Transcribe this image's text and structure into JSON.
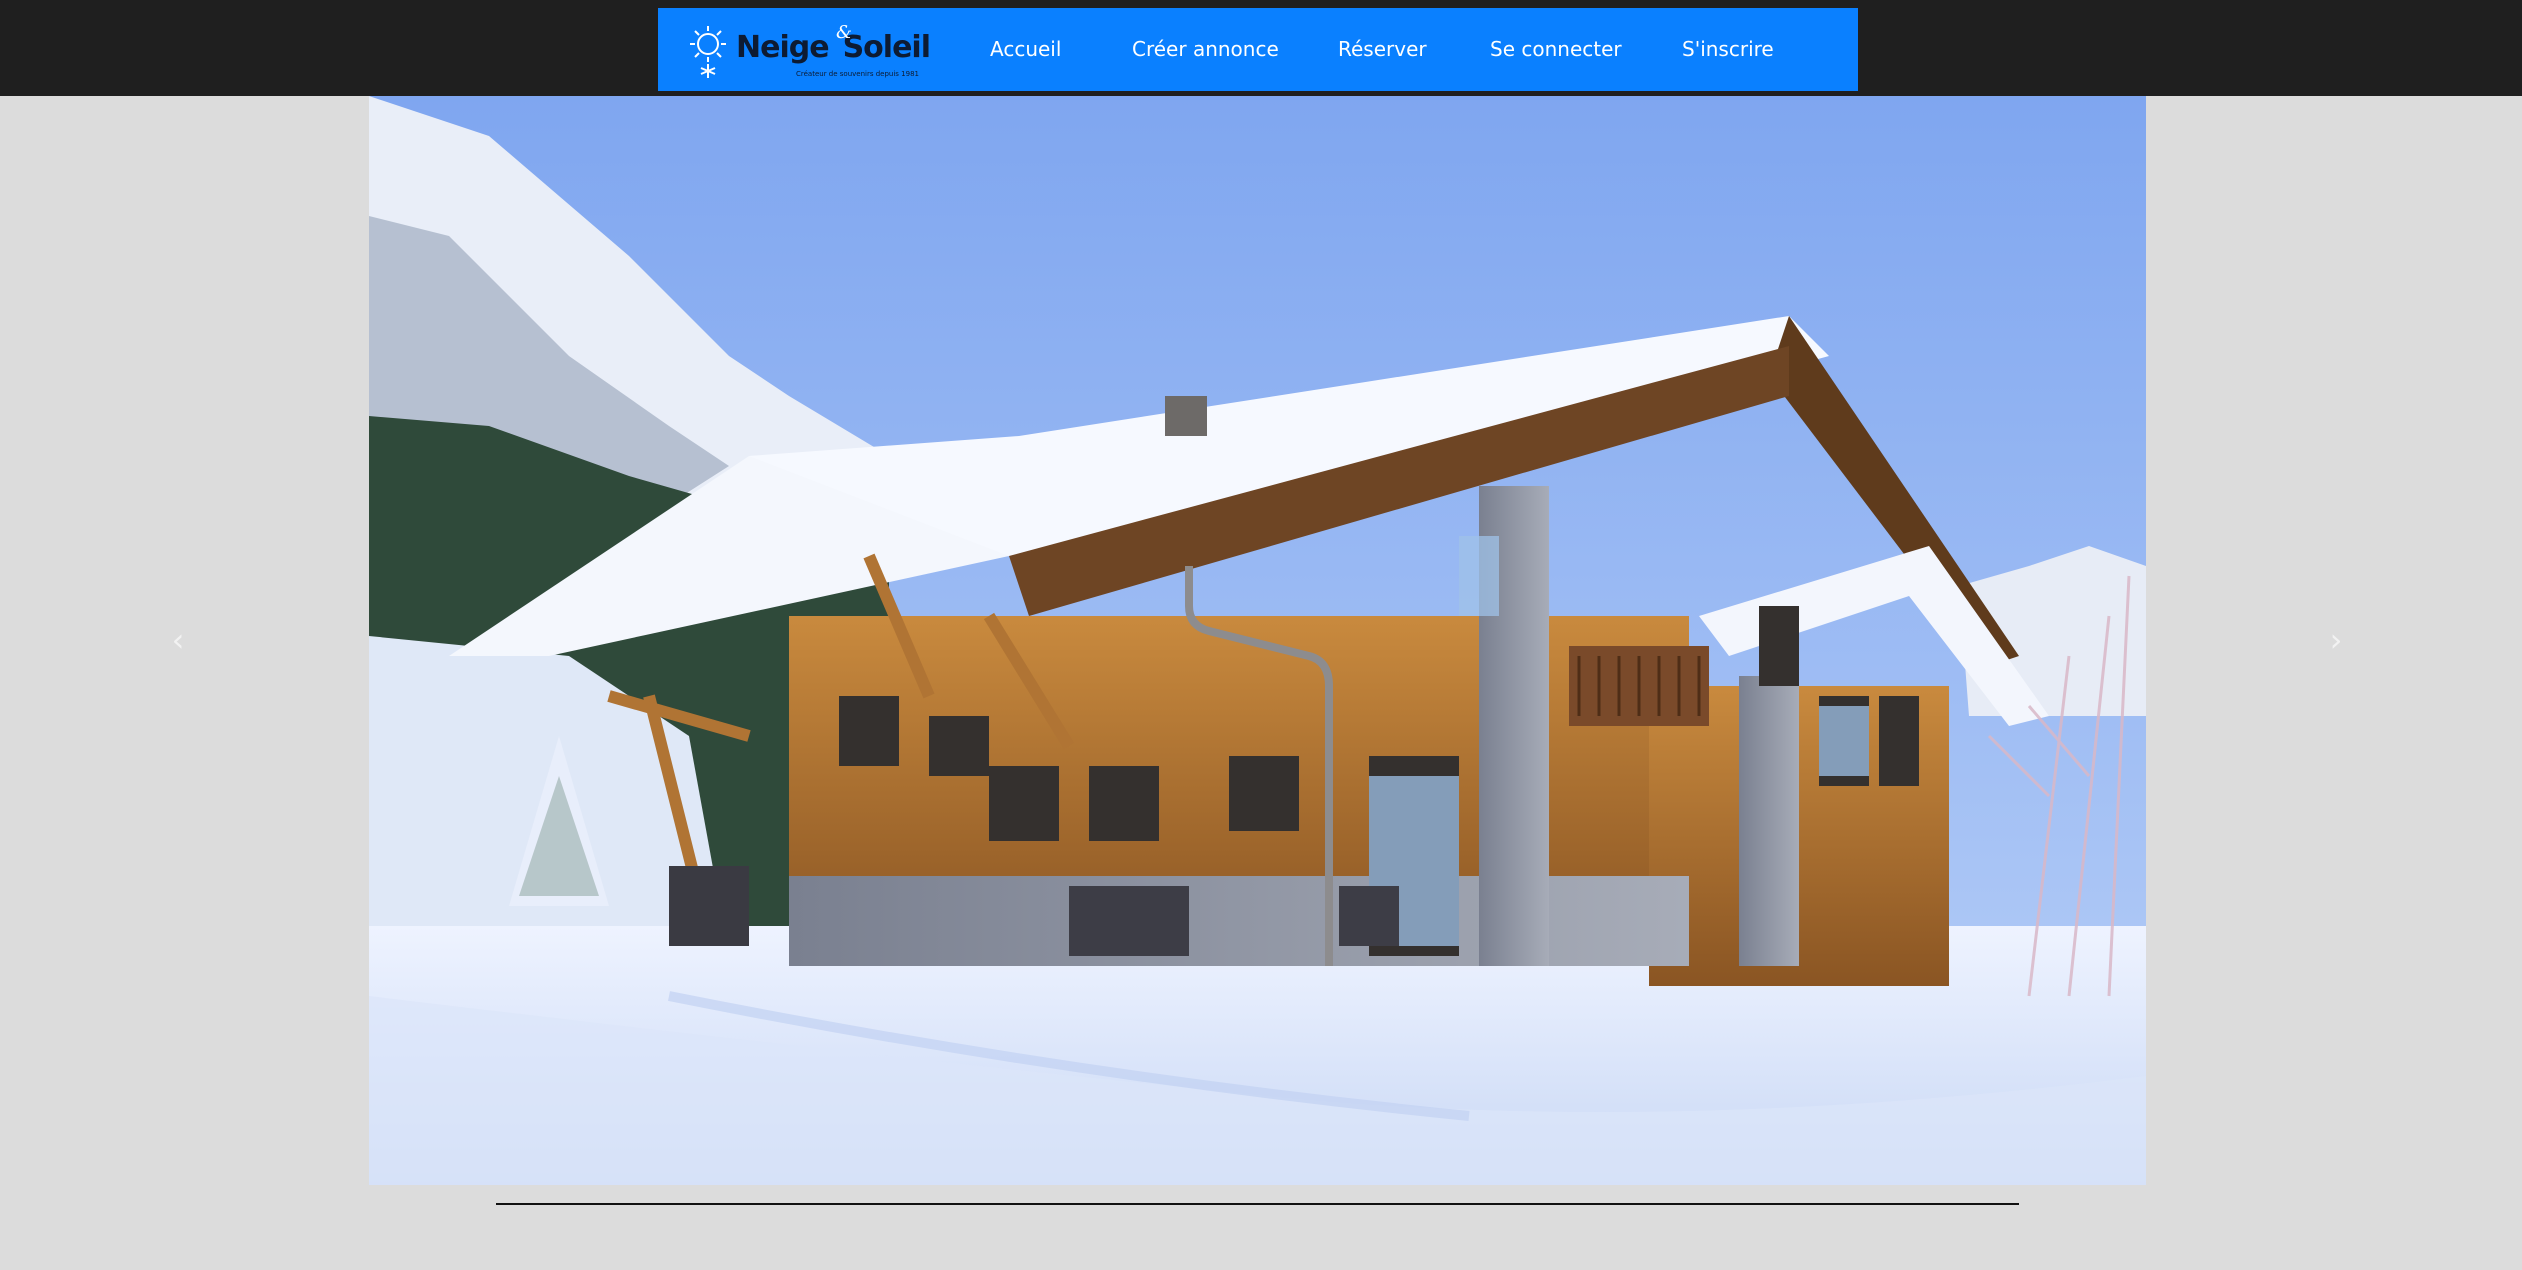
{
  "brand": {
    "name_part1": "Neige",
    "ampersand": "&",
    "name_part2": "Soleil",
    "tagline": "Créateur de souvenirs depuis 1981",
    "icon": "sun-snowflake-icon"
  },
  "nav": {
    "items": [
      {
        "label": "Accueil"
      },
      {
        "label": "Créer annonce"
      },
      {
        "label": "Réserver"
      },
      {
        "label": "Se connecter"
      },
      {
        "label": "S'inscrire"
      }
    ]
  },
  "carousel": {
    "prev_icon": "chevron-left-icon",
    "next_icon": "chevron-right-icon",
    "prev_glyph": "‹",
    "next_glyph": "›",
    "slide_description": "snowy-mountain-chalet"
  },
  "colors": {
    "topbar": "#1f1f1f",
    "nav_bg": "#0a80ff",
    "page_bg": "#dcdcdc"
  }
}
